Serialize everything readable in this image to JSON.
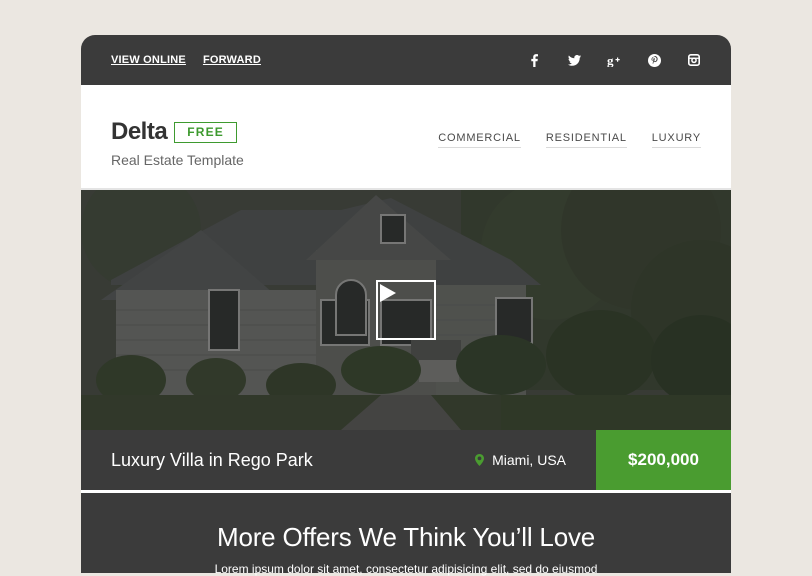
{
  "topbar": {
    "links": [
      "VIEW ONLINE",
      "FORWARD"
    ],
    "social_icons": [
      "facebook-icon",
      "twitter-icon",
      "google-plus-icon",
      "pinterest-icon",
      "instagram-icon"
    ]
  },
  "brand": {
    "logo": "Delta",
    "badge": "FREE",
    "tagline": "Real Estate Template"
  },
  "nav": [
    "COMMERCIAL",
    "RESIDENTIAL",
    "LUXURY"
  ],
  "hero": {
    "play_icon": "play-icon"
  },
  "listing": {
    "title": "Luxury Villa in Rego Park",
    "location": "Miami, USA",
    "location_icon": "map-pin-icon",
    "price": "$200,000"
  },
  "offers": {
    "heading": "More Offers We Think You’ll Love",
    "body": "Lorem ipsum dolor sit amet, consectetur adipisicing elit, sed do eiusmod"
  },
  "colors": {
    "dark": "#3b3b3b",
    "accent": "#4a9c30",
    "background": "#ebe7e1"
  }
}
